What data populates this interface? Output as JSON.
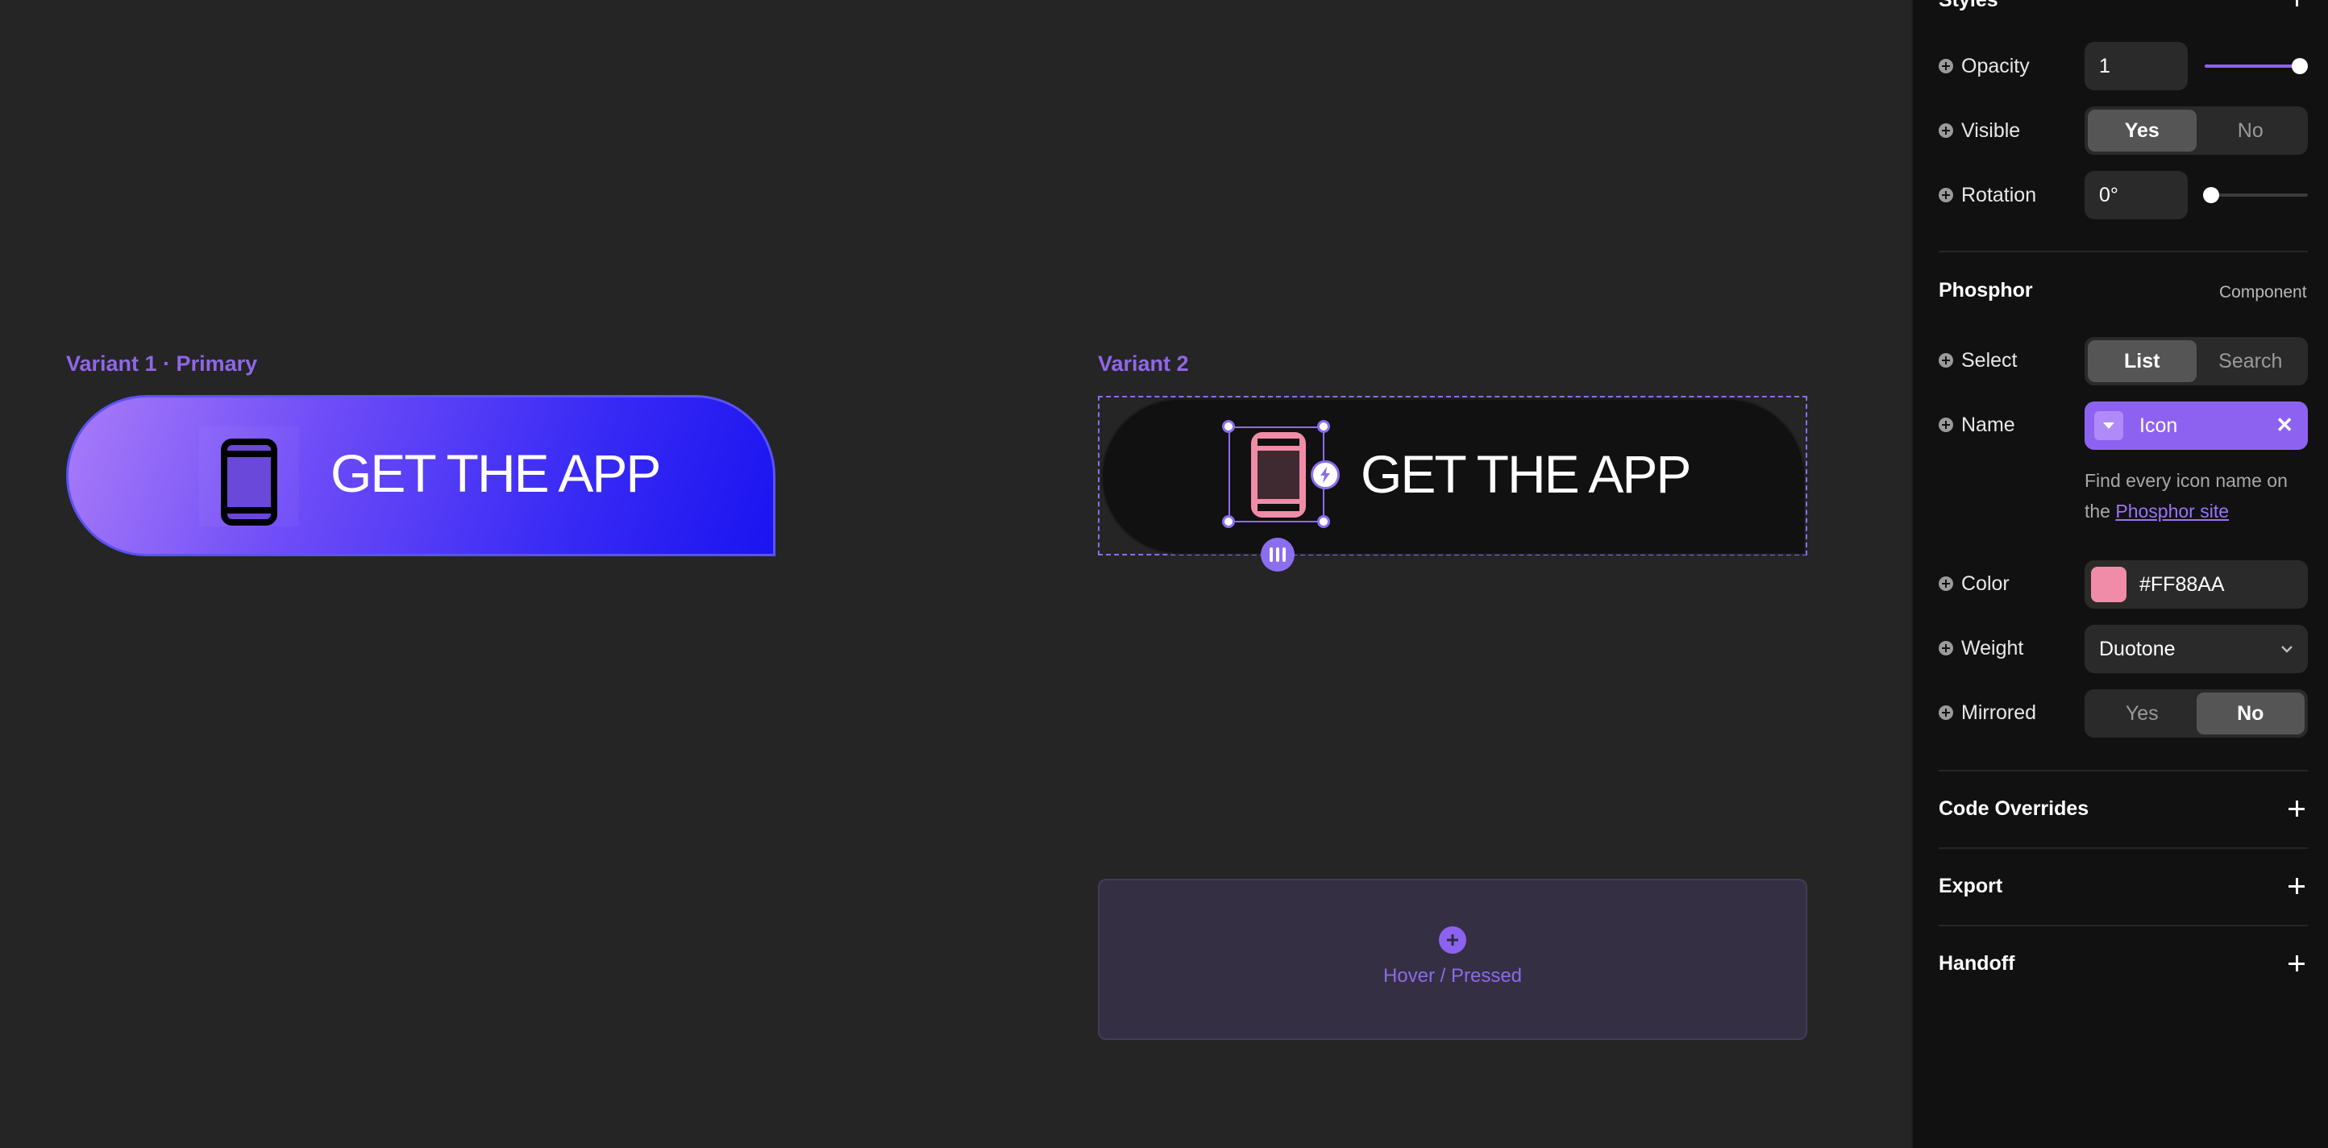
{
  "canvas": {
    "variant1": {
      "label": "Variant 1 · Primary",
      "button_text": "GET THE APP",
      "icon": "device-mobile-icon"
    },
    "variant2": {
      "label": "Variant 2",
      "button_text": "GET THE APP",
      "icon": "device-mobile-icon",
      "icon_color": "#FF88AA"
    },
    "hover_placeholder": {
      "label": "Hover / Pressed"
    }
  },
  "panel": {
    "styles": {
      "title": "Styles",
      "opacity": {
        "label": "Opacity",
        "value": "1",
        "slider_fraction": 1.0
      },
      "visible": {
        "label": "Visible",
        "options": [
          "Yes",
          "No"
        ],
        "selected": "Yes"
      },
      "rotation": {
        "label": "Rotation",
        "value": "0°",
        "slider_fraction": 0.0
      }
    },
    "phosphor": {
      "title": "Phosphor",
      "subtitle": "Component",
      "select": {
        "label": "Select",
        "options": [
          "List",
          "Search"
        ],
        "selected": "List"
      },
      "name": {
        "label": "Name",
        "value": "Icon"
      },
      "hint_prefix": "Find every icon name on the",
      "hint_link": "Phosphor site",
      "color": {
        "label": "Color",
        "value": "#FF88AA",
        "swatch": "#F08CA8"
      },
      "weight": {
        "label": "Weight",
        "value": "Duotone"
      },
      "mirrored": {
        "label": "Mirrored",
        "options": [
          "Yes",
          "No"
        ],
        "selected": "No"
      }
    },
    "sections": [
      {
        "title": "Code Overrides"
      },
      {
        "title": "Export"
      },
      {
        "title": "Handoff"
      }
    ]
  },
  "colors": {
    "accent": "#8B6DF0",
    "panel_bg": "#111111",
    "canvas_bg": "#252525"
  }
}
